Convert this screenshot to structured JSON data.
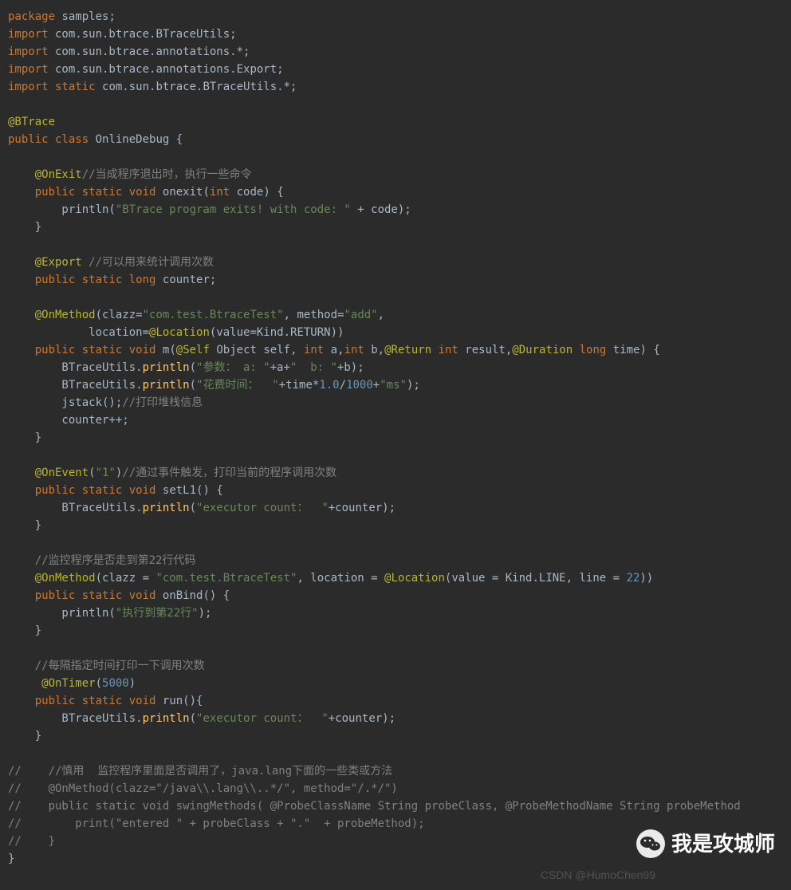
{
  "code": {
    "l1_kw": "package",
    "l1_rest": " samples;",
    "l2_kw": "import",
    "l2_rest": " com.sun.btrace.BTraceUtils;",
    "l3_kw": "import",
    "l3_rest": " com.sun.btrace.annotations.*;",
    "l4_kw": "import",
    "l4_rest": " com.sun.btrace.annotations.Export;",
    "l5a": "import",
    "l5b": " static",
    "l5c": " com.sun.btrace.BTraceUtils.*;",
    "l6": "",
    "l7": "@BTrace",
    "l8a": "public",
    "l8b": " class",
    "l8c": " OnlineDebug {",
    "l9": "",
    "l10a": "    @OnExit",
    "l10b": "//当成程序退出时，执行一些命令",
    "l11a": "    public",
    "l11b": " static",
    "l11c": " void",
    "l11d": " onexit(",
    "l11e": "int",
    "l11f": " code) {",
    "l12a": "        println(",
    "l12b": "\"BTrace program exits! with code: \"",
    "l12c": " + code);",
    "l13": "    }",
    "l14": "",
    "l15a": "    @Export ",
    "l15b": "//可以用来统计调用次数",
    "l16a": "    public",
    "l16b": " static",
    "l16c": " long",
    "l16d": " counter;",
    "l17": "",
    "l18a": "    @OnMethod",
    "l18b": "(clazz=",
    "l18c": "\"com.test.BtraceTest\"",
    "l18d": ", method=",
    "l18e": "\"add\"",
    "l18f": ",",
    "l19a": "            location=",
    "l19b": "@Location",
    "l19c": "(value=Kind.RETURN))",
    "l20a": "    public",
    "l20b": " static",
    "l20c": " void",
    "l20d": " m(",
    "l20e": "@Self",
    "l20f": " Object self, ",
    "l20g": "int",
    "l20h": " a,",
    "l20i": "int",
    "l20j": " b,",
    "l20k": "@Return",
    "l20l": " int",
    "l20m": " result,",
    "l20n": "@Duration",
    "l20o": " long",
    "l20p": " time) {",
    "l21a": "        BTraceUtils.",
    "l21b": "println",
    "l21c": "(",
    "l21d": "\"参数： a: \"",
    "l21e": "+a+",
    "l21f": "\"  b: \"",
    "l21g": "+b);",
    "l22a": "        BTraceUtils.",
    "l22b": "println",
    "l22c": "(",
    "l22d": "\"花费时间：  \"",
    "l22e": "+time*",
    "l22f": "1.0",
    "l22g": "/",
    "l22h": "1000",
    "l22i": "+",
    "l22j": "\"ms\"",
    "l22k": ");",
    "l23a": "        jstack();",
    "l23b": "//打印堆栈信息",
    "l24": "        counter++;",
    "l25": "    }",
    "l26": "",
    "l27a": "    @OnEvent",
    "l27b": "(",
    "l27c": "\"1\"",
    "l27d": ")",
    "l27e": "//通过事件触发，打印当前的程序调用次数",
    "l28a": "    public",
    "l28b": " static",
    "l28c": " void",
    "l28d": " setL1() {",
    "l29a": "        BTraceUtils.",
    "l29b": "println",
    "l29c": "(",
    "l29d": "\"executor count：  \"",
    "l29e": "+counter);",
    "l30": "    }",
    "l31": "",
    "l32": "    //监控程序是否走到第22行代码",
    "l33a": "    @OnMethod",
    "l33b": "(clazz = ",
    "l33c": "\"com.test.BtraceTest\"",
    "l33d": ", location = ",
    "l33e": "@Location",
    "l33f": "(value = Kind.LINE, line = ",
    "l33g": "22",
    "l33h": "))",
    "l34a": "    public",
    "l34b": " static",
    "l34c": " void",
    "l34d": " onBind() {",
    "l35a": "        println(",
    "l35b": "\"执行到第22行\"",
    "l35c": ");",
    "l36": "    }",
    "l37": "",
    "l38": "    //每隔指定时间打印一下调用次数",
    "l39a": "     @OnTimer",
    "l39b": "(",
    "l39c": "5000",
    "l39d": ")",
    "l40a": "    public",
    "l40b": " static",
    "l40c": " void",
    "l40d": " run(){",
    "l41a": "        BTraceUtils.",
    "l41b": "println",
    "l41c": "(",
    "l41d": "\"executor count：  \"",
    "l41e": "+counter);",
    "l42": "    }",
    "l43": "",
    "l44": "//    //慎用  监控程序里面是否调用了，java.lang下面的一些类或方法",
    "l45": "//    @OnMethod(clazz=\"/java\\\\.lang\\\\..*/\", method=\"/.*/\")",
    "l46": "//    public static void swingMethods( @ProbeClassName String probeClass, @ProbeMethodName String probeMethod",
    "l47": "//        print(\"entered \" + probeClass + \".\"  + probeMethod);",
    "l48": "//    }",
    "l49": "}"
  },
  "watermark_text": "我是攻城师",
  "footer_wm": "CSDN @HumoChen99"
}
